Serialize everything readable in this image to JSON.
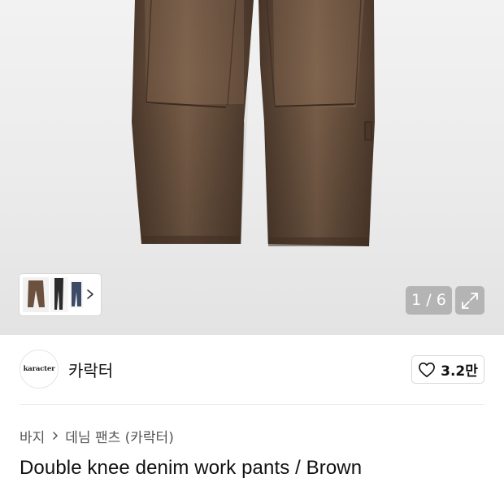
{
  "gallery": {
    "image_alt": "Double knee denim work pants brown",
    "counter": "1 / 6",
    "thumbnails": [
      "brown-pants-front",
      "black-pants",
      "blue-pants"
    ]
  },
  "icons": {
    "chevron": "chevron-right-icon",
    "expand": "expand-icon",
    "heart": "heart-icon"
  },
  "brand": {
    "logo_text": "karacter",
    "name": "카락터"
  },
  "like": {
    "count": "3.2만"
  },
  "breadcrumb": {
    "category": "바지",
    "subcategory": "데님 팬츠 (카락터)"
  },
  "product": {
    "title": "Double knee denim work pants / Brown"
  },
  "colors": {
    "denim_brown": "#5b4636",
    "text_primary": "#111111",
    "text_secondary": "#555555"
  }
}
